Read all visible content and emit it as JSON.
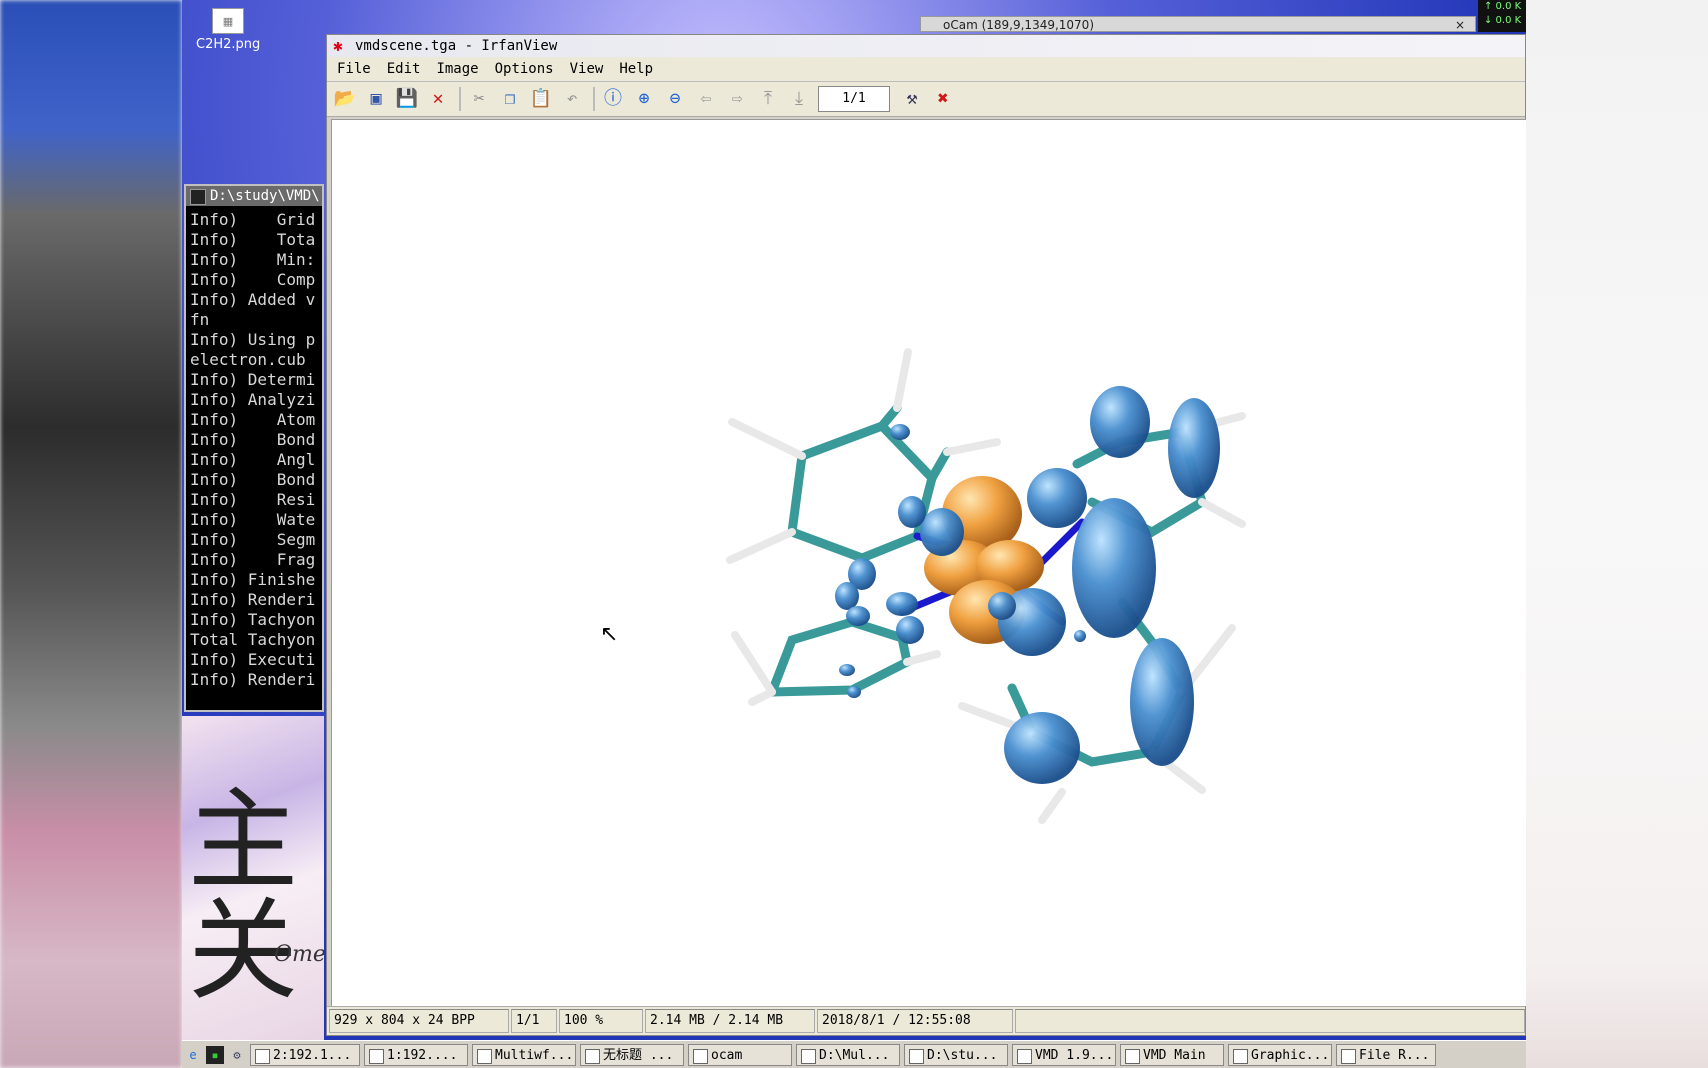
{
  "desktop": {
    "icon_label": "C2H2.png"
  },
  "ocam": {
    "title": "oCam (189,9,1349,1070)",
    "close": "×"
  },
  "netmon": {
    "up": "↑ 0.0 K",
    "down": "↓ 0.0 K"
  },
  "console": {
    "title": "D:\\study\\VMD\\",
    "lines": [
      "Info)    Grid",
      "Info)    Tota",
      "Info)    Min:",
      "Info)    Comp",
      "Info) Added v",
      "fn",
      "Info) Using p",
      "electron.cub",
      "Info) Determi",
      "Info) Analyzi",
      "Info)    Atom",
      "Info)    Bond",
      "Info)    Angl",
      "Info)    Bond",
      "Info)    Resi",
      "Info)    Wate",
      "Info)    Segm",
      "Info)    Frag",
      "Info) Finishe",
      "Info) Renderi",
      "Info) Tachyon",
      "Total Tachyon",
      "Info) Executi",
      "Info) Renderi"
    ]
  },
  "wallpaper_art": {
    "glyph": "主 关",
    "signature": "Ome"
  },
  "irfanview": {
    "title": "vmdscene.tga - IrfanView",
    "menu": [
      "File",
      "Edit",
      "Image",
      "Options",
      "View",
      "Help"
    ],
    "toolbar_icons": [
      "open-icon",
      "thumbnails-icon",
      "save-icon",
      "delete-icon",
      "cut-icon",
      "copy-icon",
      "paste-icon",
      "undo-icon",
      "info-icon",
      "zoom-in-icon",
      "zoom-out-icon",
      "previous-icon",
      "next-icon",
      "first-page-icon",
      "last-page-icon"
    ],
    "page_box": "1/1",
    "status": {
      "dimensions": "929 x 804 x 24 BPP",
      "page": "1/1",
      "zoom": "100 %",
      "size": "2.14 MB / 2.14 MB",
      "datetime": "2018/8/1 / 12:55:08"
    }
  },
  "taskbar": {
    "tasks": [
      "2:192.1...",
      "1:192....",
      "Multiwf...",
      "无标题 ...",
      "ocam",
      "D:\\Mul...",
      "D:\\stu...",
      "VMD 1.9...",
      "VMD Main",
      "Graphic...",
      "File R..."
    ]
  },
  "colors": {
    "bond": "#3a9a9a",
    "hydrogen": "#e8e8e8",
    "nitrogen": "#1a1acc",
    "orbital_blue": "#4a90d0",
    "orbital_orange": "#f0a040"
  }
}
